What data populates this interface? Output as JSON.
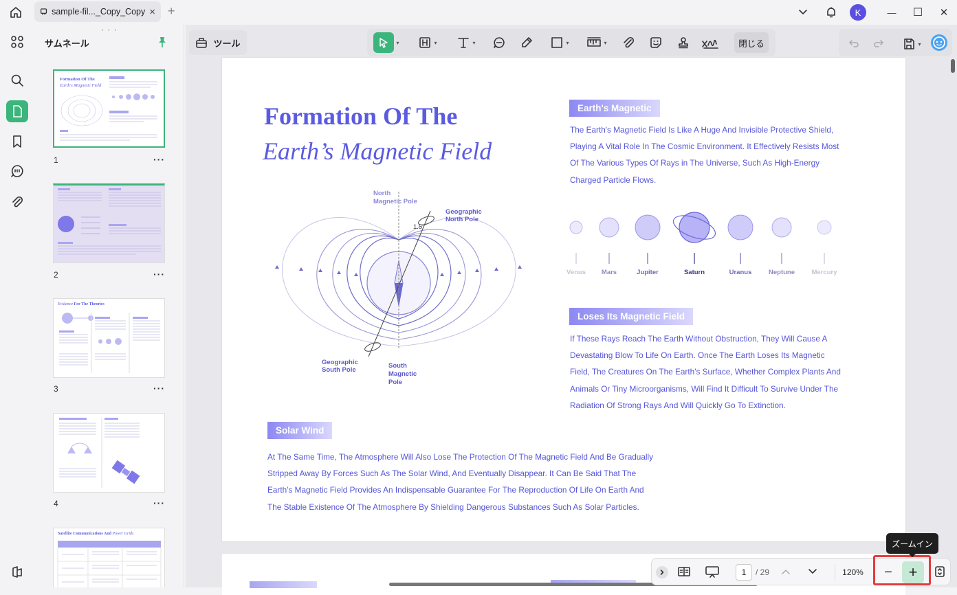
{
  "titlebar": {
    "tab_title": "sample-fil..._Copy_Copy",
    "tab_close": "×",
    "tab_add": "+",
    "avatar_initial": "K",
    "minimize": "—",
    "maximize": "☐",
    "close": "✕"
  },
  "sidebar": {
    "title": "サムネール",
    "grip": "· · ·",
    "pages": [
      {
        "num": "1",
        "more": "···"
      },
      {
        "num": "2",
        "more": "···"
      },
      {
        "num": "3",
        "more": "···"
      },
      {
        "num": "4",
        "more": "···"
      }
    ],
    "thumb_texts": {
      "p1_title1": "Formation Of The",
      "p1_title2": "Earth's Magnetic Field",
      "p3_title_em": "Evidence",
      "p3_title": "For The Theories",
      "p5_title": "Satellite Communications And",
      "p5_title_em": "Power Grids"
    }
  },
  "toolbar": {
    "tool_label": "ツール",
    "close_label": "閉じる"
  },
  "document": {
    "heading1": "Formation Of The",
    "heading2": "Earth’s Magnetic Field",
    "section1": {
      "tag": "Earth's Magnetic",
      "lines": [
        "The Earth's Magnetic Field Is Like A Huge And Invisible Protective Shield,",
        "Playing A Vital Role In The Cosmic Environment. It Effectively Resists Most",
        "Of The Various Types Of Rays in The Universe, Such As High-Energy",
        "Charged Particle Flows."
      ]
    },
    "planets": [
      {
        "name": "Venus",
        "color": "#c4c4d8"
      },
      {
        "name": "Mars",
        "color": "#8c8cc0"
      },
      {
        "name": "Jupiter",
        "color": "#6a6ab8"
      },
      {
        "name": "Saturn",
        "color": "#3a3a8c"
      },
      {
        "name": "Uranus",
        "color": "#6a6ab8"
      },
      {
        "name": "Neptune",
        "color": "#8c8cc0"
      },
      {
        "name": "Mercury",
        "color": "#c4c4d8"
      }
    ],
    "section2": {
      "tag": "Loses Its Magnetic Field",
      "lines": [
        "If These Rays Reach The Earth Without Obstruction, They Will Cause A",
        "Devastating Blow To Life On Earth. Once The Earth Loses Its Magnetic",
        "Field, The Creatures On The Earth's Surface, Whether Complex Plants And",
        "Animals Or Tiny Microorganisms, Will Find It Difficult To Survive Under The",
        "Radiation Of Strong Rays And Will Quickly Go To Extinction."
      ]
    },
    "section3": {
      "tag": "Solar Wind",
      "lines": [
        "At The Same Time, The Atmosphere Will Also Lose The Protection Of The Magnetic Field And Be Gradually",
        "Stripped Away By Forces Such As The Solar Wind, And Eventually Disappear. It Can Be Said That The",
        "Earth's Magnetic Field Provides An Indispensable Guarantee For The Reproduction Of Life On Earth And",
        "The Stable Existence Of The Atmosphere By Shielding Dangerous Substances Such As Solar Particles."
      ]
    },
    "diagram": {
      "north_magnetic": [
        "North",
        "Magnetic Pole"
      ],
      "geographic_north": [
        "Geographic",
        "North Pole"
      ],
      "angle": "1.5",
      "geographic_south": [
        "Geographic",
        "South Pole"
      ],
      "south_magnetic": [
        "South",
        "Magnetic",
        "Pole"
      ]
    }
  },
  "navbar": {
    "current_page": "1",
    "total_pages": "/ 29",
    "zoom": "120%",
    "zoom_out": "−",
    "zoom_in": "+",
    "tooltip": "ズームイン"
  },
  "colors": {
    "accent_green": "#3bb57c",
    "text_purple": "#5656d9",
    "highlight_red": "#e23c3c"
  }
}
